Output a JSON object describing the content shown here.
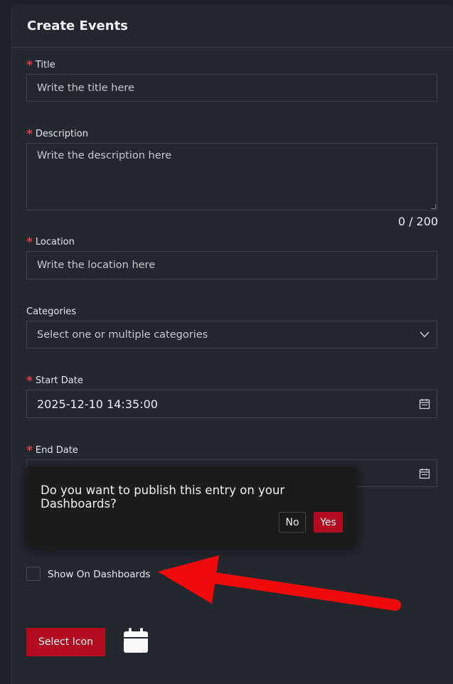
{
  "header": {
    "title": "Create Events"
  },
  "form": {
    "title": {
      "label": "Title",
      "placeholder": "Write the title here"
    },
    "description": {
      "label": "Description",
      "placeholder": "Write the description here",
      "counter": "0 / 200"
    },
    "location": {
      "label": "Location",
      "placeholder": "Write the location here"
    },
    "categories": {
      "label": "Categories",
      "placeholder": "Select one or multiple categories"
    },
    "start_date": {
      "label": "Start Date",
      "value": "2025-12-10 14:35:00"
    },
    "end_date": {
      "label": "End Date",
      "value": ""
    },
    "required_mark": "*"
  },
  "popover": {
    "message": "Do you want to publish this entry on your Dashboards?",
    "no_label": "No",
    "yes_label": "Yes"
  },
  "show_on_dashboards": {
    "label": "Show On Dashboards",
    "checked": false
  },
  "select_icon": {
    "label": "Select Icon",
    "icon": "calendar-icon"
  },
  "colors": {
    "accent": "#b20a1f",
    "required": "#e03a4a",
    "annotation_arrow": "#f00a0a"
  }
}
